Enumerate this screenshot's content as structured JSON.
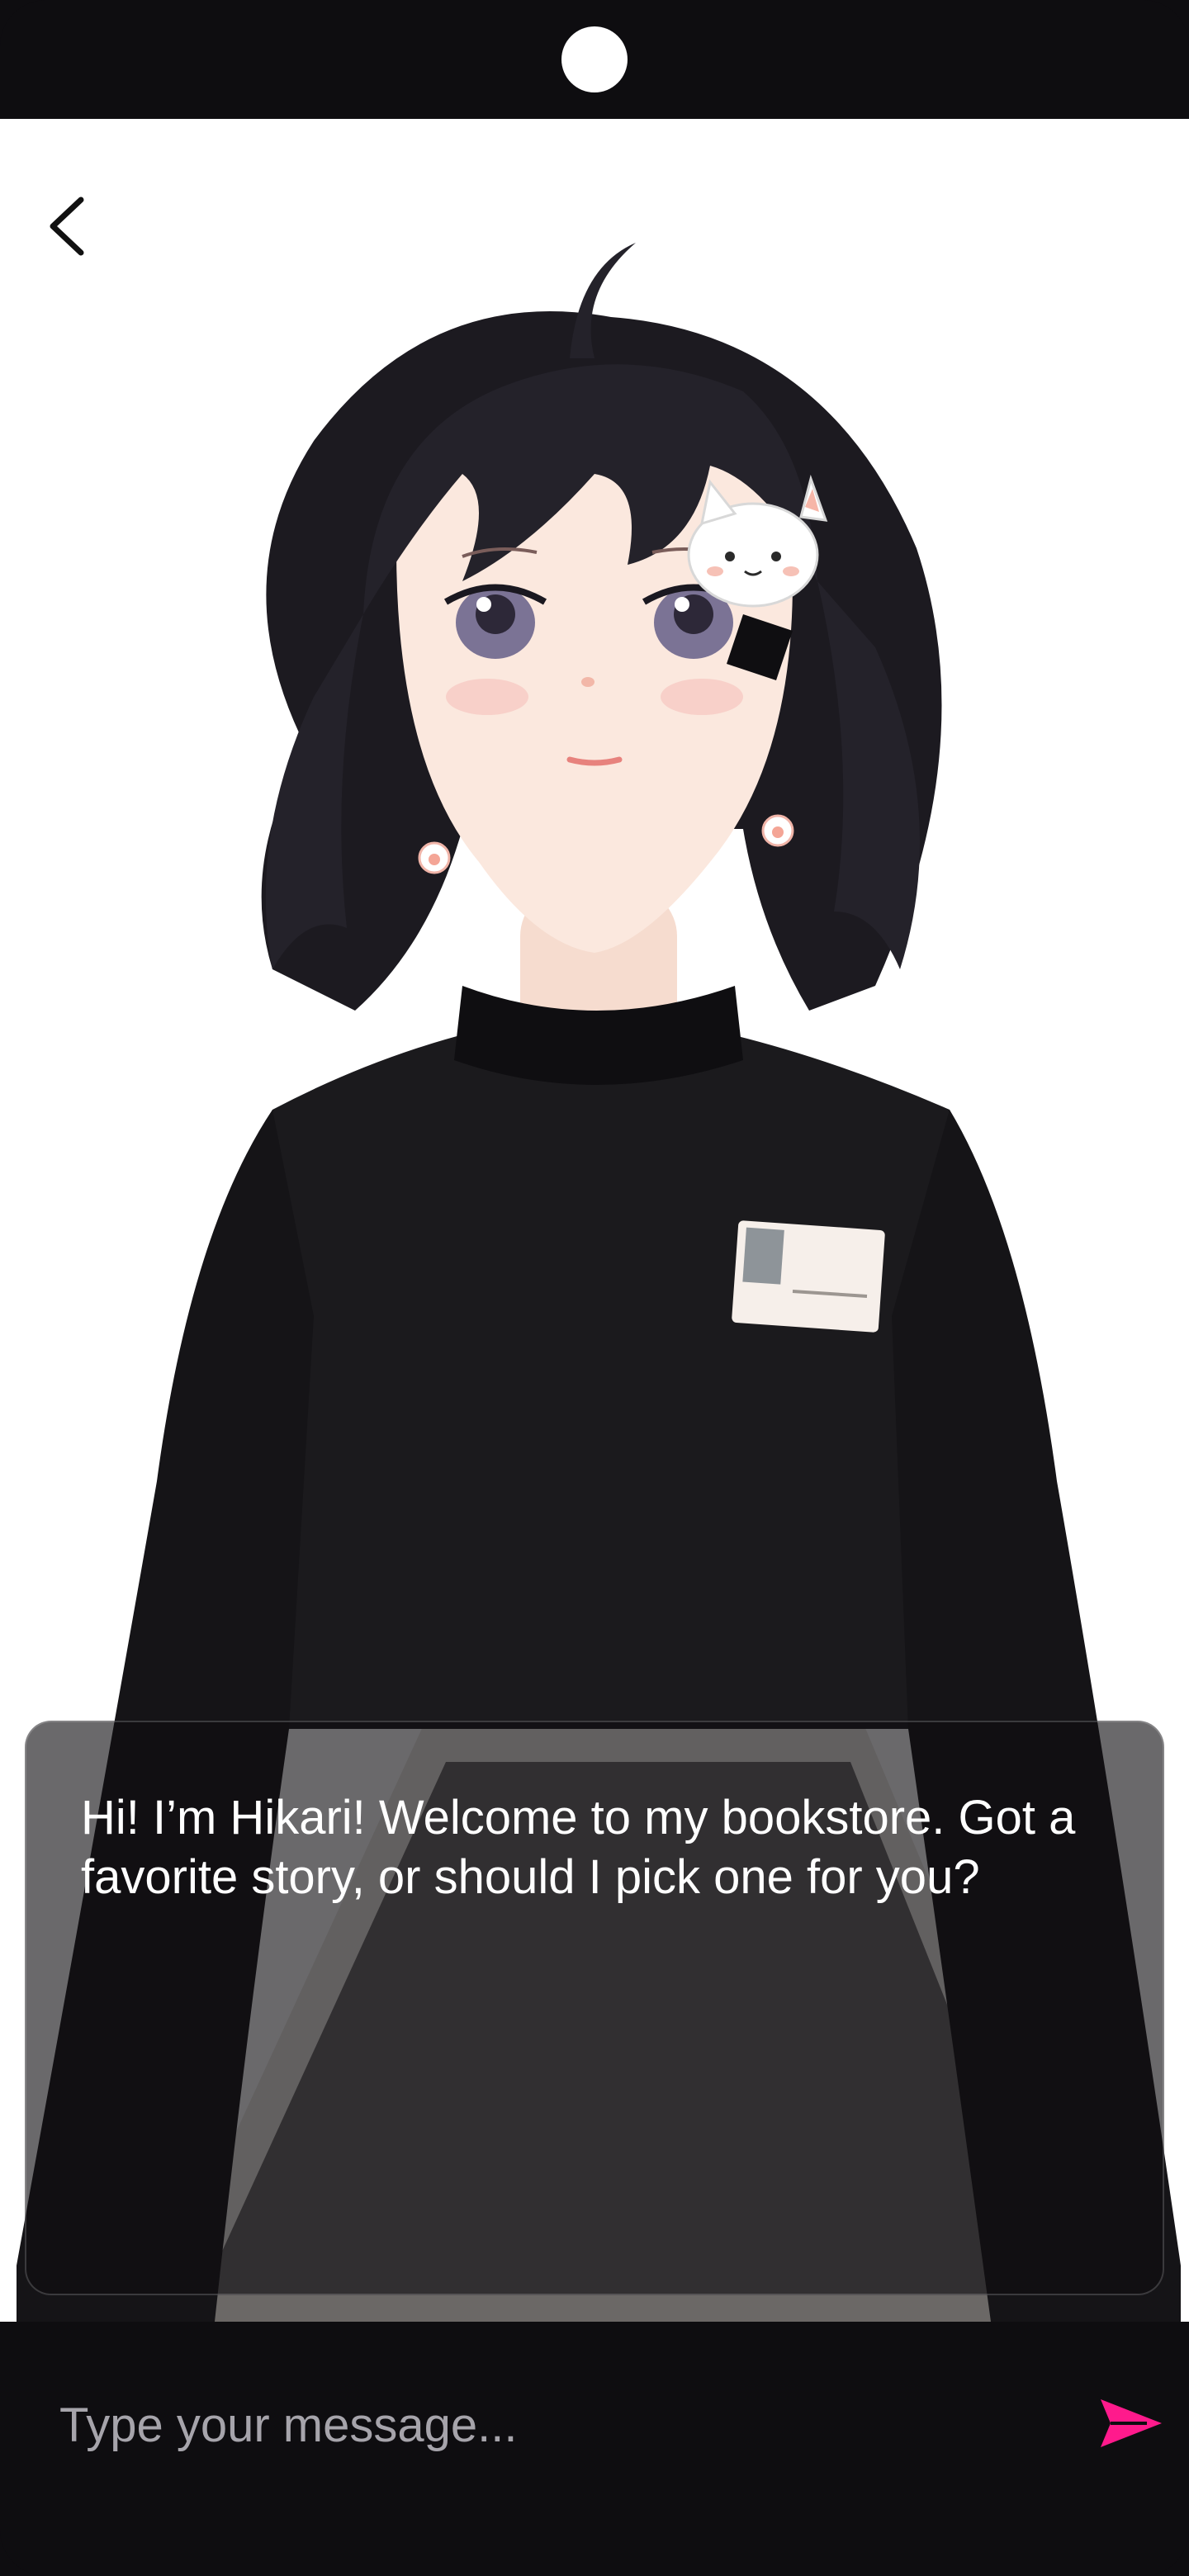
{
  "app": {
    "colors": {
      "background": "#0e0d10",
      "scene": "#ffffff",
      "accent": "#ff1a8c",
      "placeholder": "#a6a4ab"
    }
  },
  "header": {
    "back_icon": "chevron-left-icon"
  },
  "character": {
    "illustration": "anime girl with short black hair, cat hair clip, black sweater, grey skirt"
  },
  "dialog": {
    "message": "Hi! I’m Hikari! Welcome to my bookstore. Got a favorite story, or should I pick one for you?"
  },
  "composer": {
    "placeholder": "Type your message...",
    "value": "",
    "send_icon": "send-icon"
  }
}
